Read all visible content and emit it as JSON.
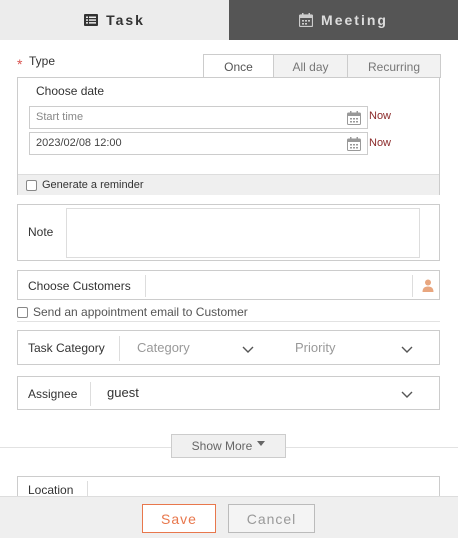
{
  "tabs": {
    "task": "Task",
    "meeting": "Meeting"
  },
  "type": {
    "label": "Type",
    "required_mark": "*",
    "options": [
      "Once",
      "All day",
      "Recurring"
    ],
    "selected": "Once"
  },
  "date": {
    "title": "Choose date",
    "start_placeholder": "Start time",
    "end_value": "2023/02/08 12:00",
    "now_label": "Now",
    "reminder_label": "Generate a reminder"
  },
  "note": {
    "label": "Note"
  },
  "customers": {
    "label": "Choose Customers",
    "send_email_label": "Send an appointment email to Customer"
  },
  "category": {
    "label": "Task Category",
    "category_placeholder": "Category",
    "priority_placeholder": "Priority"
  },
  "assignee": {
    "label": "Assignee",
    "value": "guest"
  },
  "show_more": "Show More",
  "location": {
    "label": "Location"
  },
  "footer": {
    "save": "Save",
    "cancel": "Cancel"
  },
  "colors": {
    "accent": "#e8774c",
    "now_link": "#8b2a2a",
    "required": "#d9534f",
    "active_tab_bg": "#555555"
  }
}
